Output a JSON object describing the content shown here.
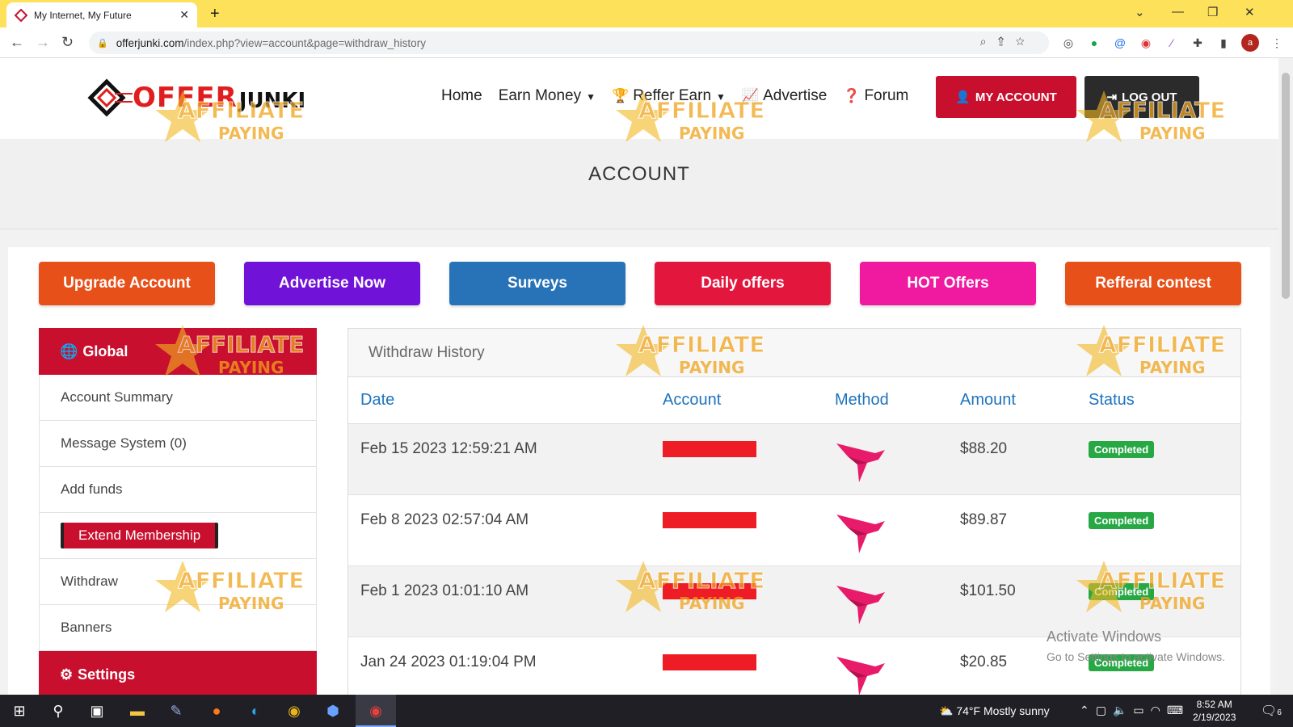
{
  "browser": {
    "tab_title": "My Internet, My Future",
    "url_host": "offerjunki.com",
    "url_path": "/index.php?view=account&page=withdraw_history",
    "profile_initial": "a"
  },
  "site": {
    "logo_offer": "OFFER",
    "logo_junki": "JUNKI",
    "nav": {
      "home": "Home",
      "earn_money": "Earn Money",
      "reffer_earn": "Reffer Earn",
      "advertise": "Advertise",
      "forum": "Forum"
    },
    "my_account": "MY ACCOUNT",
    "log_out": "LOG OUT",
    "page_heading": "ACCOUNT"
  },
  "quick_buttons": [
    {
      "label": "Upgrade Account",
      "color": "#e8501a"
    },
    {
      "label": "Advertise Now",
      "color": "#7112d8"
    },
    {
      "label": "Surveys",
      "color": "#2872b8"
    },
    {
      "label": "Daily offers",
      "color": "#e3173e"
    },
    {
      "label": "HOT Offers",
      "color": "#ef1aa0"
    },
    {
      "label": "Refferal contest",
      "color": "#e8501a"
    }
  ],
  "sidebar": {
    "global_heading": "Global",
    "items": [
      "Account Summary",
      "Message System (0)",
      "Add funds",
      "Extend Membership",
      "Withdraw",
      "Banners"
    ],
    "settings_heading": "Settings"
  },
  "withdraw": {
    "title": "Withdraw History",
    "columns": [
      "Date",
      "Account",
      "Method",
      "Amount",
      "Status"
    ],
    "rows": [
      {
        "date": "Feb 15 2023 12:59:21 AM",
        "amount": "$88.20",
        "status": "Completed"
      },
      {
        "date": "Feb 8 2023 02:57:04 AM",
        "amount": "$89.87",
        "status": "Completed"
      },
      {
        "date": "Feb 1 2023 01:01:10 AM",
        "amount": "$101.50",
        "status": "Completed"
      },
      {
        "date": "Jan 24 2023 01:19:04 PM",
        "amount": "$20.85",
        "status": "Completed"
      }
    ]
  },
  "watermark": {
    "line1": "AFFILIATE",
    "line2": "PAYING"
  },
  "os_notice": {
    "line1": "Activate Windows",
    "line2": "Go to Settings to activate Windows."
  },
  "taskbar": {
    "temperature": "74°F",
    "weather": "Mostly sunny",
    "time": "8:52 AM",
    "date": "2/19/2023",
    "notifications": "6"
  },
  "colors": {
    "brand_red": "#c8102e",
    "link_blue": "#1e73be",
    "status_green": "#28a745",
    "tab_bar": "#fde15a"
  }
}
